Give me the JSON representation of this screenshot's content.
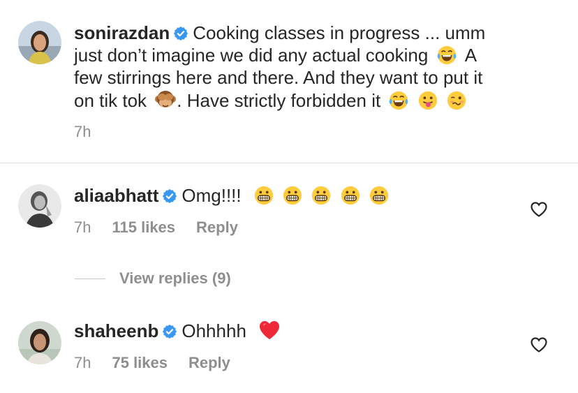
{
  "caption": {
    "username": "sonirazdan",
    "text_line1": "Cooking classes in progress ... umm",
    "text_line2": "just don’t imagine we did any actual cooking",
    "text_line2b": "A",
    "text_line3": "few stirrings here and there. And they want to put it",
    "text_line4a": "on tik tok",
    "text_line4b": ". Have strictly forbidden it",
    "time": "7h"
  },
  "comments": [
    {
      "username": "aliaabhatt",
      "text": "Omg!!!!",
      "time": "7h",
      "likes": "115 likes",
      "reply": "Reply"
    },
    {
      "username": "shaheenb",
      "text": "Ohhhhh",
      "time": "7h",
      "likes": "75 likes",
      "reply": "Reply"
    }
  ],
  "view_replies": "View replies (9)",
  "colors": {
    "text": "#262626",
    "secondary": "#8e8e8e",
    "verified": "#3897f0",
    "divider": "#dbdbdb",
    "heart": "#ed2939"
  },
  "icons": [
    "verified-badge-icon",
    "heart-outline-icon",
    "tears-of-joy-emoji",
    "see-no-evil-monkey-emoji",
    "tongue-out-emoji",
    "woozy-face-emoji",
    "grimacing-face-emoji",
    "red-heart-emoji"
  ]
}
